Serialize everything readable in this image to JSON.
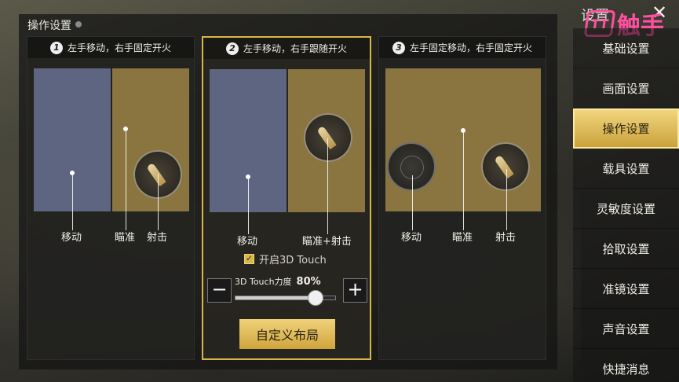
{
  "page_title": "操作设置",
  "menu_header": "设置",
  "logo_text": "触手",
  "logo_mark": "TT",
  "options": [
    {
      "number": "1",
      "title": "左手移动，右手固定开火",
      "labels": [
        "移动",
        "瞄准",
        "射击"
      ]
    },
    {
      "number": "2",
      "title": "左手移动，右手跟随开火",
      "labels": [
        "移动",
        "瞄准+射击"
      ]
    },
    {
      "number": "3",
      "title": "左手固定移动，右手固定开火",
      "labels": [
        "移动",
        "瞄准",
        "射击"
      ]
    }
  ],
  "touch3d": {
    "checkbox_label": "开启3D Touch",
    "checked": true,
    "strength_label": "3D Touch力度",
    "strength_value": "80%",
    "strength_fraction": 0.8,
    "minus": "−",
    "plus": "+"
  },
  "custom_layout_button": "自定义布局",
  "menu": {
    "items": [
      {
        "label": "基础设置",
        "active": false
      },
      {
        "label": "画面设置",
        "active": false
      },
      {
        "label": "操作设置",
        "active": true
      },
      {
        "label": "载具设置",
        "active": false
      },
      {
        "label": "灵敏度设置",
        "active": false
      },
      {
        "label": "拾取设置",
        "active": false
      },
      {
        "label": "准镜设置",
        "active": false
      },
      {
        "label": "声音设置",
        "active": false
      },
      {
        "label": "快捷消息",
        "active": false
      }
    ]
  },
  "colors": {
    "accent_gold": "#d9b64a",
    "zone_blue": "#5d6580",
    "zone_gold": "#8a7540",
    "logo_pink": "#ff4fa0"
  }
}
